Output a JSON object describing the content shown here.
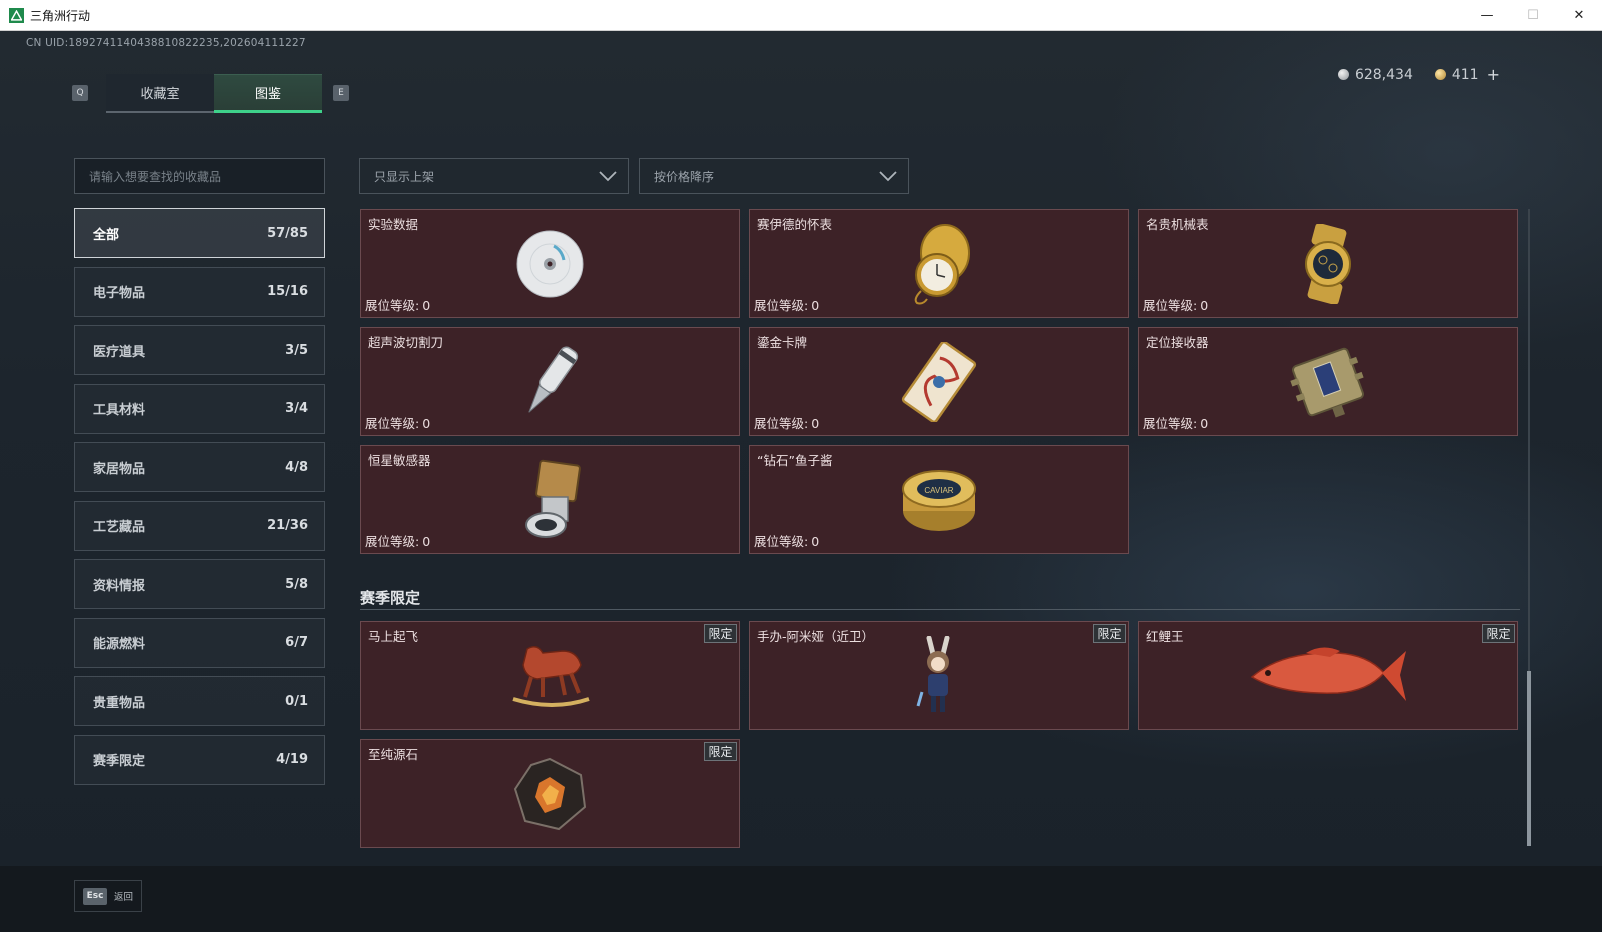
{
  "window": {
    "title": "三角洲行动",
    "minimize": "—",
    "maximize": "☐",
    "close": "✕"
  },
  "header": {
    "uid": "CN UID:1892741140438810822235,202604111227",
    "hotkey_left": "Q",
    "hotkey_right": "E",
    "tabs": [
      {
        "label": "收藏室",
        "active": false
      },
      {
        "label": "图鉴",
        "active": true
      }
    ],
    "currency": [
      {
        "icon": "silver-coin-icon",
        "value": "628,434"
      },
      {
        "icon": "gold-coin-icon",
        "value": "411"
      }
    ],
    "add_label": "+"
  },
  "search": {
    "placeholder": "请输入想要查找的收藏品"
  },
  "filters": {
    "display": "只显示上架",
    "sort": "按价格降序"
  },
  "categories": [
    {
      "label": "全部",
      "count": "57/85",
      "active": true
    },
    {
      "label": "电子物品",
      "count": "15/16"
    },
    {
      "label": "医疗道具",
      "count": "3/5"
    },
    {
      "label": "工具材料",
      "count": "3/4"
    },
    {
      "label": "家居物品",
      "count": "4/8"
    },
    {
      "label": "工艺藏品",
      "count": "21/36"
    },
    {
      "label": "资料情报",
      "count": "5/8"
    },
    {
      "label": "能源燃料",
      "count": "6/7"
    },
    {
      "label": "贵重物品",
      "count": "0/1"
    },
    {
      "label": "赛季限定",
      "count": "4/19"
    }
  ],
  "level_label": "展位等级:",
  "items": [
    {
      "name": "实验数据",
      "level": "0",
      "icon": "cd-disc-icon"
    },
    {
      "name": "赛伊德的怀表",
      "level": "0",
      "icon": "pocket-watch-icon"
    },
    {
      "name": "名贵机械表",
      "level": "0",
      "icon": "wristwatch-icon"
    },
    {
      "name": "超声波切割刀",
      "level": "0",
      "icon": "scalpel-icon"
    },
    {
      "name": "鎏金卡牌",
      "level": "0",
      "icon": "gilded-card-icon"
    },
    {
      "name": "定位接收器",
      "level": "0",
      "icon": "receiver-icon"
    },
    {
      "name": "恒星敏感器",
      "level": "0",
      "icon": "star-sensor-icon"
    },
    {
      "name": "“钻石”鱼子酱",
      "level": "0",
      "icon": "caviar-tin-icon"
    }
  ],
  "season_section": {
    "title": "赛季限定",
    "badge": "限定",
    "items": [
      {
        "name": "马上起飞",
        "icon": "rocking-horse-icon"
      },
      {
        "name": "手办-阿米娅（近卫）",
        "icon": "figure-icon"
      },
      {
        "name": "红鲤王",
        "icon": "red-carp-icon"
      },
      {
        "name": "至纯源石",
        "icon": "originium-crystal-icon"
      }
    ]
  },
  "footer": {
    "esc_key": "Esc",
    "esc_label": "返回"
  }
}
